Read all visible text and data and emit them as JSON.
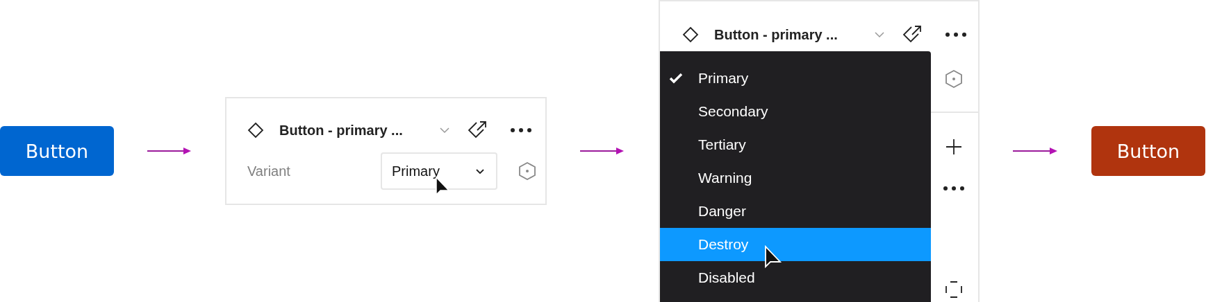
{
  "start_button": {
    "label": "Button"
  },
  "closed_panel": {
    "title": "Button - primary ...",
    "property_label": "Variant",
    "property_value": "Primary"
  },
  "open_panel": {
    "title": "Button - primary ...",
    "options": [
      {
        "label": "Primary",
        "checked": true,
        "selected": false
      },
      {
        "label": "Secondary",
        "checked": false,
        "selected": false
      },
      {
        "label": "Tertiary",
        "checked": false,
        "selected": false
      },
      {
        "label": "Warning",
        "checked": false,
        "selected": false
      },
      {
        "label": "Danger",
        "checked": false,
        "selected": false
      },
      {
        "label": "Destroy",
        "checked": false,
        "selected": true
      },
      {
        "label": "Disabled",
        "checked": false,
        "selected": false
      }
    ]
  },
  "result_button": {
    "label": "Button"
  }
}
